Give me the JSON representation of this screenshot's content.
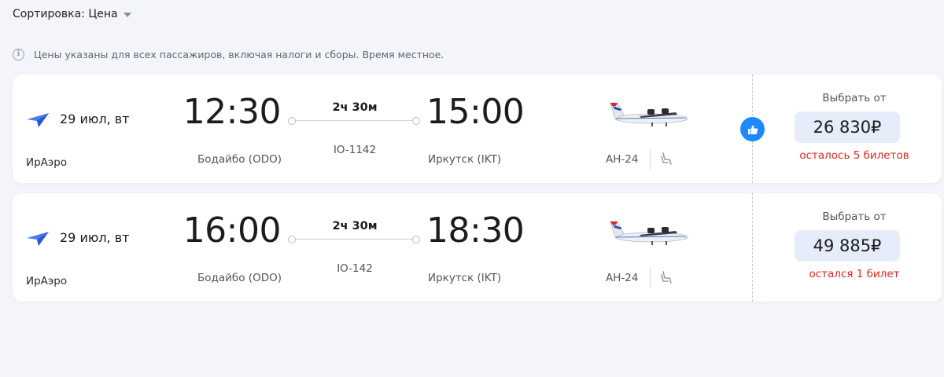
{
  "sort": {
    "label": "Сортировка: Цена"
  },
  "notice": {
    "icon": "info-icon",
    "text": "Цены указаны для всех пассажиров, включая налоги и сборы. Время местное."
  },
  "colors": {
    "accent": "#1e88ff",
    "price_bg": "#e6ecfa",
    "warning": "#e0271f"
  },
  "flights": [
    {
      "date": "29 июл, вт",
      "airline": "ИрАэро",
      "departure_time": "12:30",
      "departure_airport": "Бодайбо (ODO)",
      "duration": "2ч 30м",
      "flight_number": "IO-1142",
      "arrival_time": "15:00",
      "arrival_airport": "Иркутск (IKT)",
      "aircraft": "АН-24",
      "select_label": "Выбрать от",
      "price": "26 830₽",
      "seats_left": "осталось 5 билетов",
      "recommended": true
    },
    {
      "date": "29 июл, вт",
      "airline": "ИрАэро",
      "departure_time": "16:00",
      "departure_airport": "Бодайбо (ODO)",
      "duration": "2ч 30м",
      "flight_number": "IO-142",
      "arrival_time": "18:30",
      "arrival_airport": "Иркутск (IKT)",
      "aircraft": "АН-24",
      "select_label": "Выбрать от",
      "price": "49 885₽",
      "seats_left": "остался 1 билет",
      "recommended": false
    }
  ]
}
